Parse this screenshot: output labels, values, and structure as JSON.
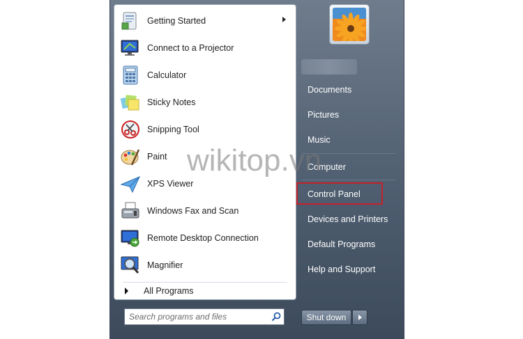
{
  "programs": [
    {
      "label": "Getting Started",
      "icon": "getting-started-icon",
      "has_submenu": true
    },
    {
      "label": "Connect to a Projector",
      "icon": "projector-icon",
      "has_submenu": false
    },
    {
      "label": "Calculator",
      "icon": "calculator-icon",
      "has_submenu": false
    },
    {
      "label": "Sticky Notes",
      "icon": "sticky-notes-icon",
      "has_submenu": false
    },
    {
      "label": "Snipping Tool",
      "icon": "snipping-tool-icon",
      "has_submenu": false
    },
    {
      "label": "Paint",
      "icon": "paint-icon",
      "has_submenu": false
    },
    {
      "label": "XPS Viewer",
      "icon": "xps-viewer-icon",
      "has_submenu": false
    },
    {
      "label": "Windows Fax and Scan",
      "icon": "fax-scan-icon",
      "has_submenu": false
    },
    {
      "label": "Remote Desktop Connection",
      "icon": "remote-desktop-icon",
      "has_submenu": false
    },
    {
      "label": "Magnifier",
      "icon": "magnifier-icon",
      "has_submenu": false
    }
  ],
  "all_programs": {
    "label": "All Programs"
  },
  "search": {
    "placeholder": "Search programs and files",
    "value": ""
  },
  "right_panel": {
    "items": [
      {
        "label": "Documents"
      },
      {
        "label": "Pictures"
      },
      {
        "label": "Music"
      },
      {
        "label": "Computer"
      },
      {
        "label": "Control Panel",
        "highlighted": true
      },
      {
        "label": "Devices and Printers"
      },
      {
        "label": "Default Programs"
      },
      {
        "label": "Help and Support"
      }
    ]
  },
  "shutdown": {
    "label": "Shut down"
  },
  "watermark": {
    "text": "wikitop.vn"
  },
  "colors": {
    "highlight_border": "#c3222a",
    "panel_bg": "#4f5e70"
  }
}
